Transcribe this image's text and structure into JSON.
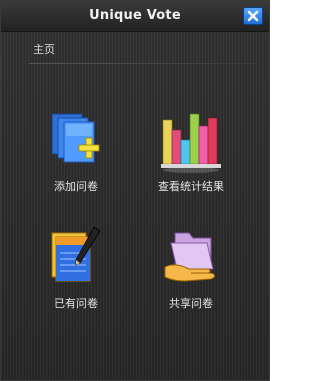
{
  "window": {
    "title": "Unique Vote",
    "close_icon": "close-icon"
  },
  "breadcrumb": {
    "label": "主页"
  },
  "tiles": [
    {
      "label": "添加问卷",
      "icon": "add-survey-icon"
    },
    {
      "label": "查看统计结果",
      "icon": "bar-chart-icon"
    },
    {
      "label": "已有问卷",
      "icon": "notepad-pen-icon"
    },
    {
      "label": "共享问卷",
      "icon": "shared-folder-icon"
    }
  ],
  "colors": {
    "background": "#2b2b2b",
    "close_button": "#2f86ff",
    "text": "#e6e6e6"
  }
}
